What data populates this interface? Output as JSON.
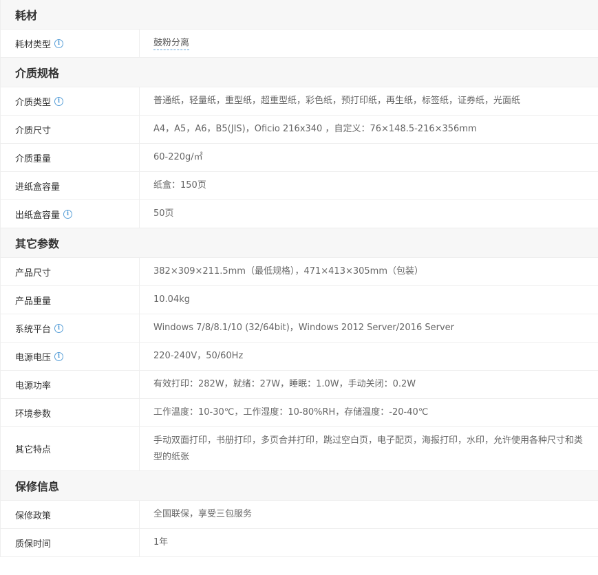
{
  "sections": {
    "consumables": {
      "title": "耗材",
      "rows": [
        {
          "label": "耗材类型",
          "value": "鼓粉分离"
        }
      ]
    },
    "media": {
      "title": "介质规格",
      "rows": [
        {
          "label": "介质类型",
          "value": "普通纸，轻量纸，重型纸，超重型纸，彩色纸，预打印纸，再生纸，标签纸，证券纸，光面纸"
        },
        {
          "label": "介质尺寸",
          "value": "A4，A5，A6，B5(JIS)，Oficio 216x340 ，自定义：76×148.5-216×356mm"
        },
        {
          "label": "介质重量",
          "value": "60-220g/㎡"
        },
        {
          "label": "进纸盒容量",
          "value": "纸盒：150页"
        },
        {
          "label": "出纸盒容量",
          "value": "50页"
        }
      ]
    },
    "other": {
      "title": "其它参数",
      "rows": [
        {
          "label": "产品尺寸",
          "value": "382×309×211.5mm（最低规格），471×413×305mm（包装）"
        },
        {
          "label": "产品重量",
          "value": "10.04kg"
        },
        {
          "label": "系统平台",
          "value": "Windows 7/8/8.1/10 (32/64bit)，Windows 2012 Server/2016 Server"
        },
        {
          "label": "电源电压",
          "value": "220-240V，50/60Hz"
        },
        {
          "label": "电源功率",
          "value": "有效打印：282W，就绪：27W，睡眠：1.0W，手动关闭：0.2W"
        },
        {
          "label": "环境参数",
          "value": "工作温度：10-30℃，工作湿度：10-80%RH，存储温度：-20-40℃"
        },
        {
          "label": "其它特点",
          "value": "手动双面打印，书册打印，多页合并打印，跳过空白页，电子配页，海报打印，水印，允许使用各种尺寸和类型的纸张"
        }
      ]
    },
    "warranty": {
      "title": "保修信息",
      "rows": [
        {
          "label": "保修政策",
          "value": "全国联保，享受三包服务"
        },
        {
          "label": "质保时间",
          "value": "1年"
        }
      ]
    }
  },
  "icons": {
    "info": "i",
    "info_color": "#5aa0d8"
  }
}
